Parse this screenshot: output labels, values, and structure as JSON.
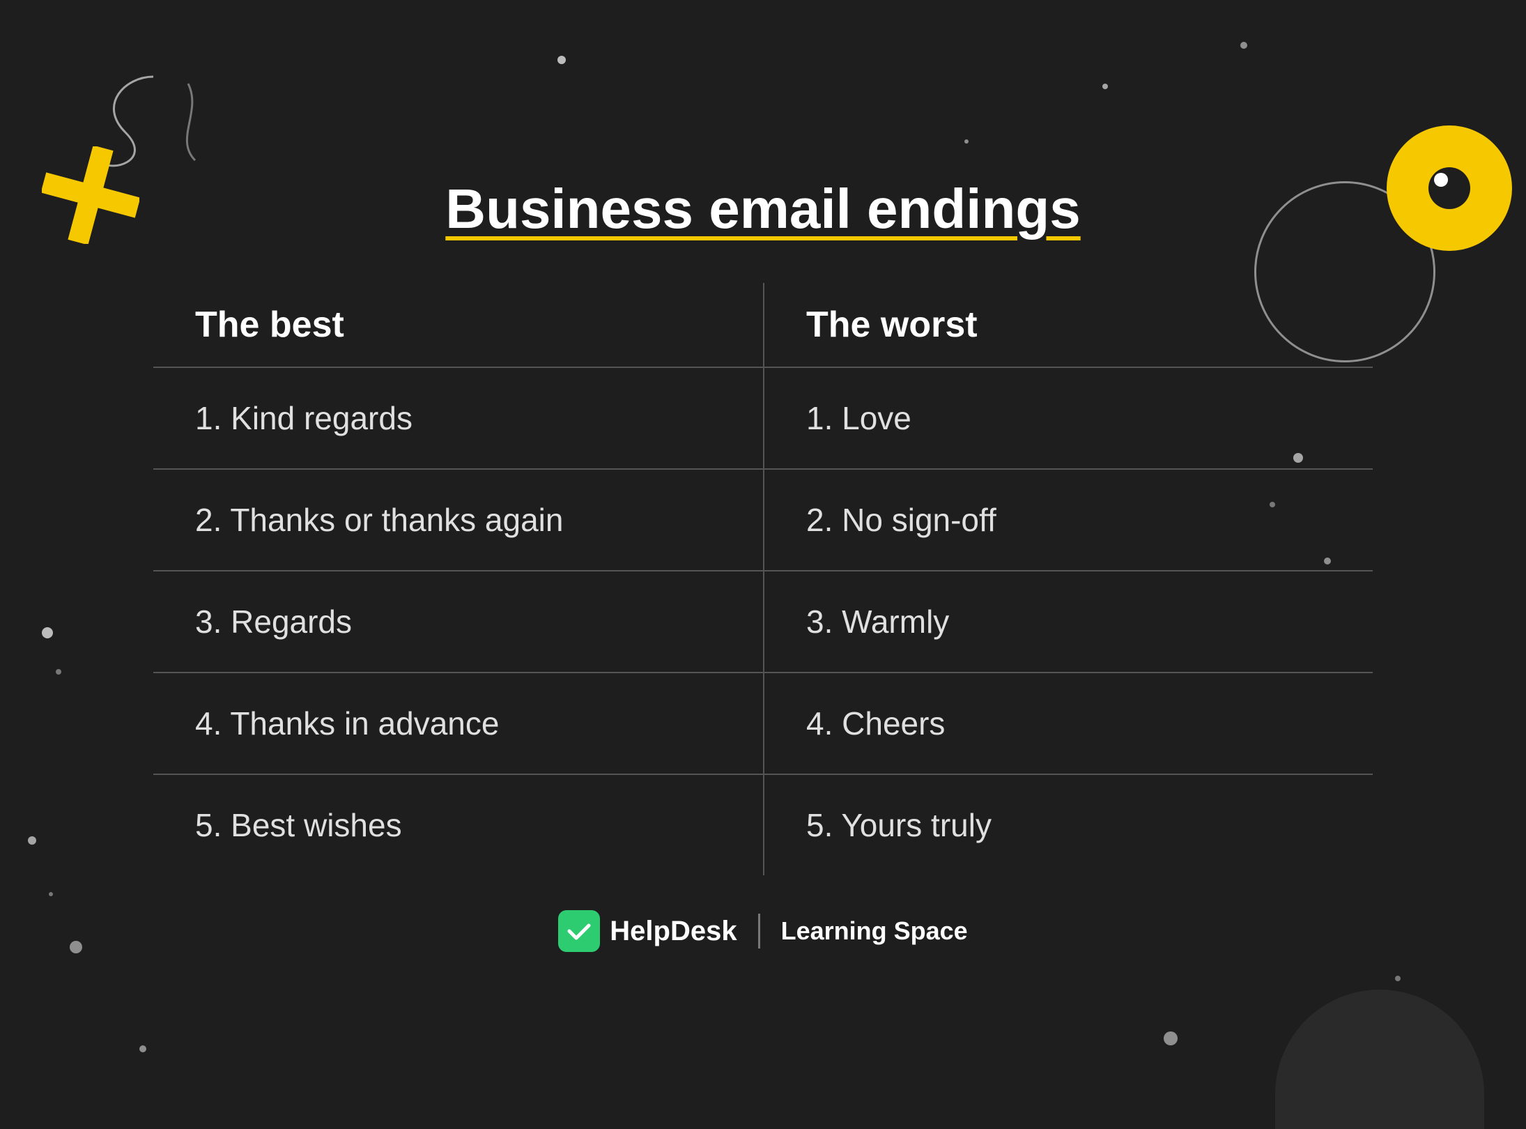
{
  "title": "Business email endings",
  "columns": {
    "left_header": "The best",
    "right_header": "The worst"
  },
  "rows": [
    {
      "left": "1. Kind regards",
      "right": "1. Love"
    },
    {
      "left": "2. Thanks or thanks again",
      "right": "2. No sign-off"
    },
    {
      "left": "3. Regards",
      "right": "3. Warmly"
    },
    {
      "left": "4. Thanks in advance",
      "right": "4. Cheers"
    },
    {
      "left": "5. Best wishes",
      "right": "5. Yours truly"
    }
  ],
  "footer": {
    "brand": "HelpDesk",
    "subtitle": "Learning Space"
  },
  "colors": {
    "background": "#1e1e1e",
    "yellow": "#f5c800",
    "green": "#2ecc71",
    "text": "#ffffff",
    "cell_text": "#e0e0e0",
    "divider": "#555555"
  }
}
